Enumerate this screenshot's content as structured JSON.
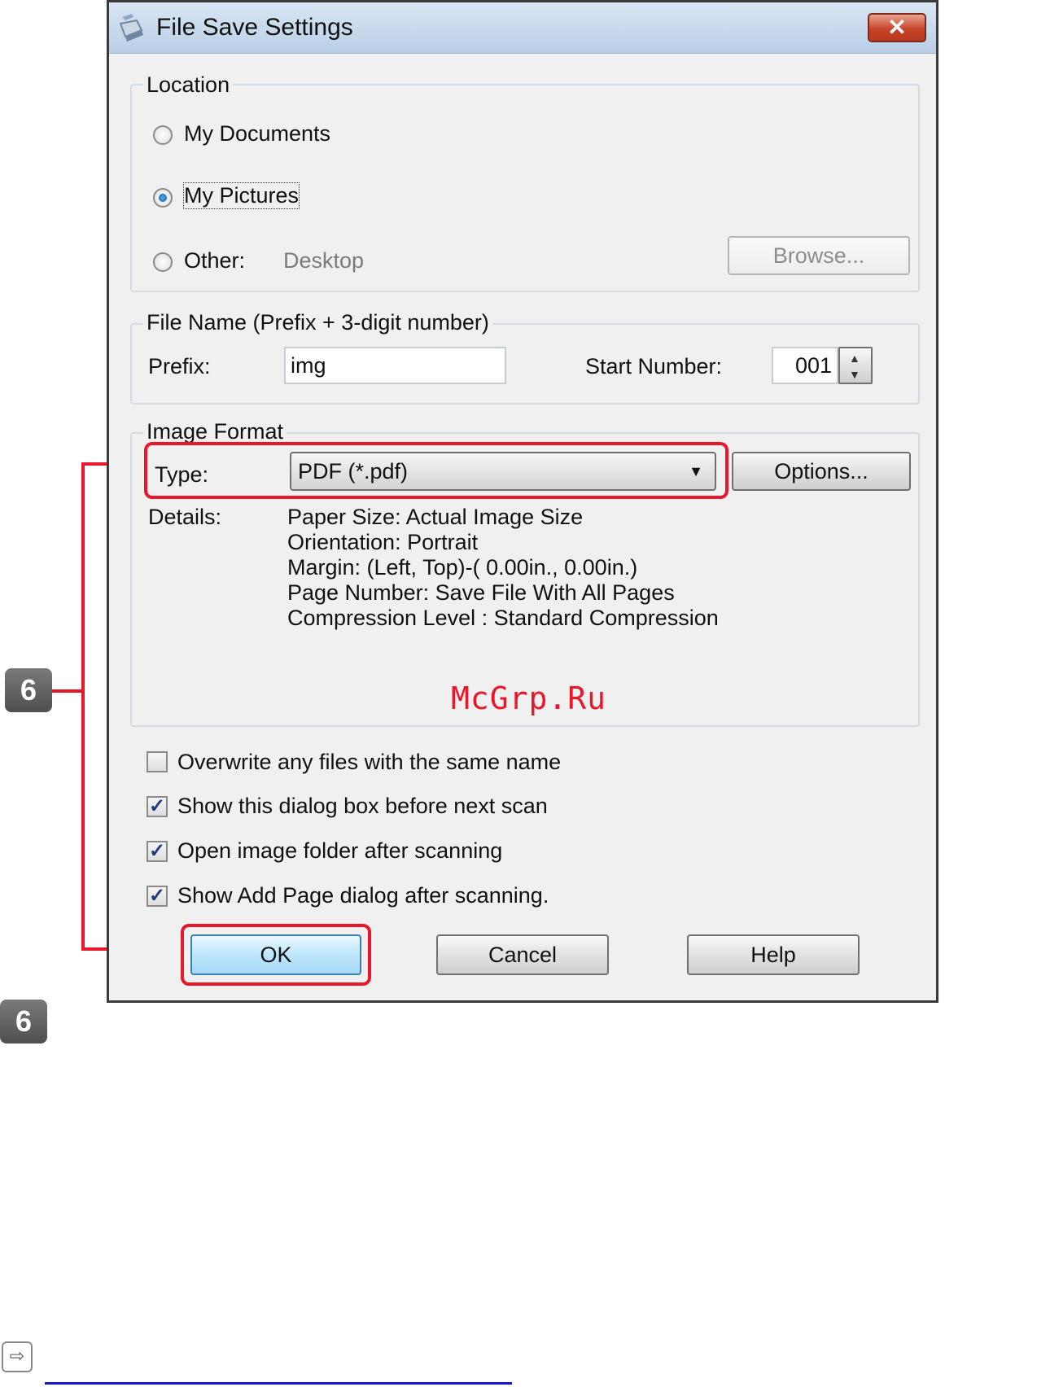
{
  "window": {
    "title": "File Save Settings",
    "close_label": "✕"
  },
  "location": {
    "legend": "Location",
    "options": [
      {
        "label": "My Documents",
        "checked": false
      },
      {
        "label": "My Pictures",
        "checked": true
      },
      {
        "label": "Other:",
        "checked": false
      }
    ],
    "other_value": "Desktop",
    "browse_label": "Browse..."
  },
  "file_name": {
    "legend": "File Name (Prefix + 3-digit number)",
    "prefix_label": "Prefix:",
    "prefix_value": "img",
    "start_number_label": "Start Number:",
    "start_number_value": "001"
  },
  "image_format": {
    "legend": "Image Format",
    "type_label": "Type:",
    "type_value": "PDF (*.pdf)",
    "options_label": "Options...",
    "details_label": "Details:",
    "details": [
      "Paper Size: Actual Image Size",
      "Orientation: Portrait",
      "Margin: (Left, Top)-( 0.00in., 0.00in.)",
      "Page Number: Save File With All Pages",
      "Compression Level : Standard Compression"
    ]
  },
  "checkboxes": [
    {
      "label": "Overwrite any files with the same name",
      "checked": false
    },
    {
      "label": "Show this dialog box before next scan",
      "checked": true
    },
    {
      "label": "Open image folder after scanning",
      "checked": true
    },
    {
      "label": "Show Add Page dialog after scanning.",
      "checked": true
    }
  ],
  "buttons": {
    "ok": "OK",
    "cancel": "Cancel",
    "help": "Help"
  },
  "callouts": {
    "badge_top": "6",
    "badge_bottom": "6"
  },
  "watermark": "McGrp.Ru",
  "colors": {
    "highlight": "#e8172a",
    "badge": "#5f5f5f"
  }
}
